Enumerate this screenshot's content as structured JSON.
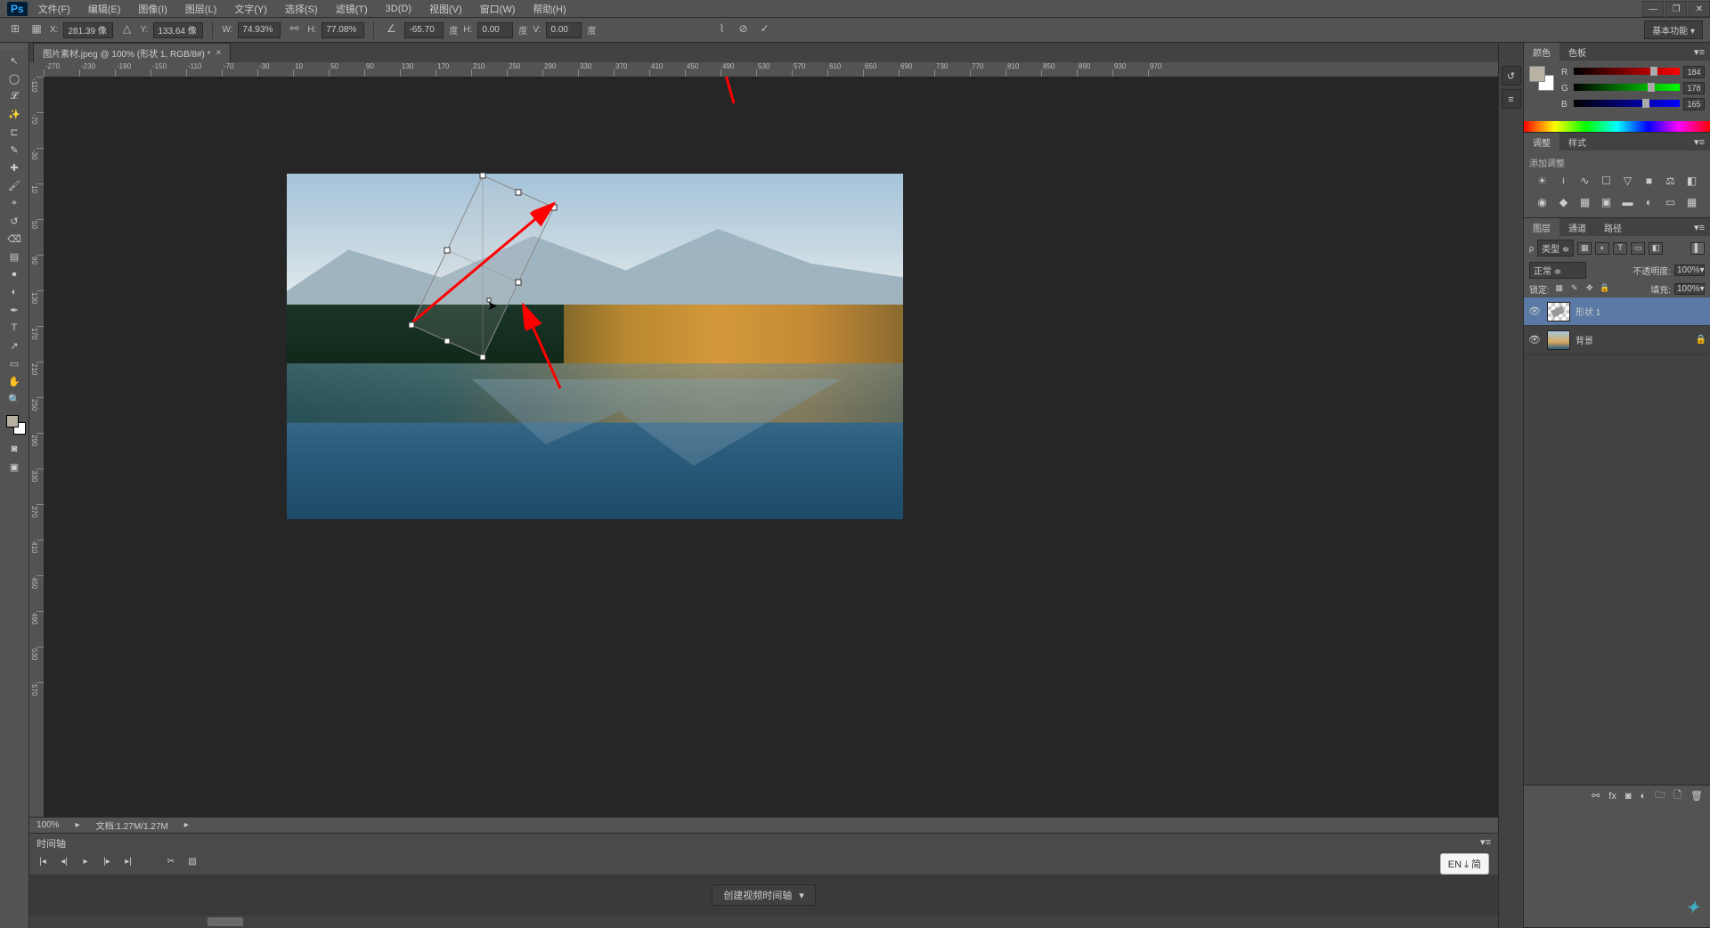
{
  "menu": [
    "文件(F)",
    "编辑(E)",
    "图像(I)",
    "图层(L)",
    "文字(Y)",
    "选择(S)",
    "滤镜(T)",
    "3D(D)",
    "视图(V)",
    "窗口(W)",
    "帮助(H)"
  ],
  "options": {
    "x_label": "X:",
    "x": "281.39 像",
    "y_label": "Y:",
    "y": "133.64 像",
    "w_label": "W:",
    "w": "74.93%",
    "h_label": "H:",
    "h": "77.08%",
    "angle_label": "",
    "angle": "-65.70",
    "angle_unit": "度",
    "h_skew_label": "H:",
    "h_skew": "0.00",
    "h_skew_unit": "度",
    "v_skew_label": "V:",
    "v_skew": "0.00",
    "v_skew_unit": "度",
    "workspace": "基本功能"
  },
  "document": {
    "tab_title": "图片素材.jpeg @ 100% (形状 1, RGB/8#) *",
    "zoom": "100%",
    "doc_info": "文档:1.27M/1.27M"
  },
  "timeline": {
    "title": "时间轴",
    "create_btn": "创建视频时间轴"
  },
  "color_panel": {
    "tabs": [
      "颜色",
      "色板"
    ],
    "r_label": "R",
    "r_val": "184",
    "g_label": "G",
    "g_val": "178",
    "b_label": "B",
    "b_val": "165",
    "fg_color": "#b8b2a5"
  },
  "adjustments_panel": {
    "tabs": [
      "调整",
      "样式"
    ],
    "label": "添加调整"
  },
  "layers_panel": {
    "tabs": [
      "图层",
      "通道",
      "路径"
    ],
    "filter_label": "类型",
    "blend_mode": "正常",
    "opacity_label": "不透明度:",
    "opacity": "100%",
    "lock_label": "锁定:",
    "fill_label": "填充:",
    "fill": "100%",
    "layers": [
      {
        "name": "形状 1",
        "selected": true,
        "visible": true,
        "thumb": "checker",
        "locked": false
      },
      {
        "name": "背景",
        "selected": false,
        "visible": true,
        "thumb": "img",
        "locked": true
      }
    ]
  },
  "ime": "EN ⤓ 简",
  "icons": {
    "move": "↖",
    "marquee": "◯",
    "lasso": "𝓛",
    "wand": "✨",
    "crop": "⊏",
    "eyedropper": "✎",
    "heal": "✚",
    "brush": "🖌",
    "stamp": "⌖",
    "history": "↺",
    "eraser": "⌫",
    "gradient": "▤",
    "blur": "●",
    "dodge": "◐",
    "pen": "✒",
    "type": "T",
    "path": "↗",
    "shape": "▭",
    "hand": "✋",
    "zoom": "🔍",
    "quickmask": "◙",
    "screenmode": "▣"
  }
}
